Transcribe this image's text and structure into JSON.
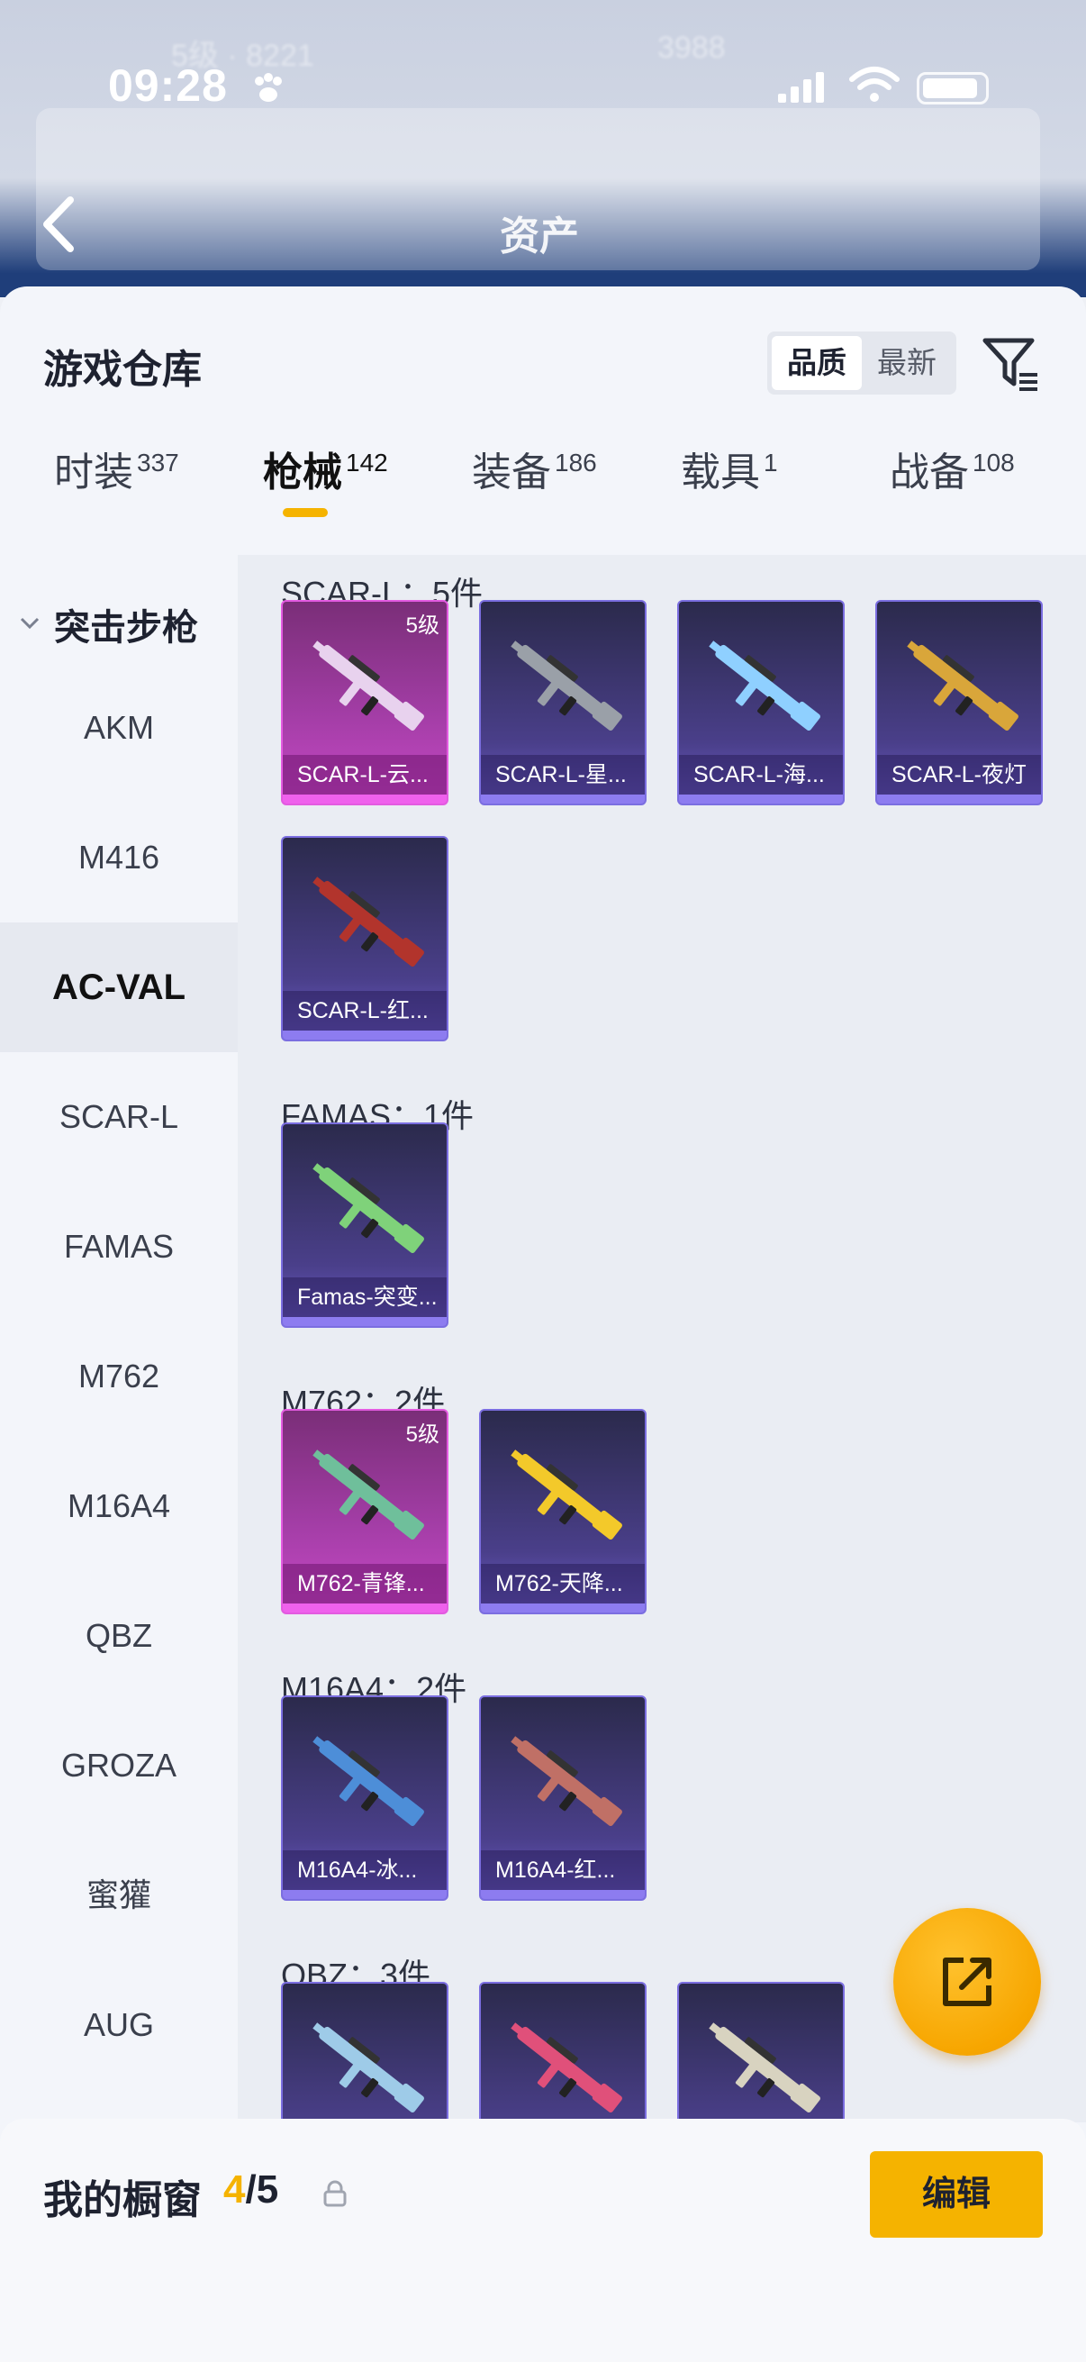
{
  "header": {
    "time": "09:28",
    "page_title": "资产"
  },
  "warehouse": {
    "title": "游戏仓库",
    "sort_options": [
      "品质",
      "最新"
    ],
    "sort_active": "品质"
  },
  "category_tabs": [
    {
      "label": "时装",
      "count": "337"
    },
    {
      "label": "枪械",
      "count": "142",
      "active": true
    },
    {
      "label": "装备",
      "count": "186"
    },
    {
      "label": "载具",
      "count": "1"
    },
    {
      "label": "战备",
      "count": "108"
    }
  ],
  "sidebar": {
    "group": "突击步枪",
    "items": [
      "AKM",
      "M416",
      "AC-VAL",
      "SCAR-L",
      "FAMAS",
      "M762",
      "M16A4",
      "QBZ",
      "GROZA",
      "蜜獾",
      "AUG"
    ],
    "active": "AC-VAL"
  },
  "sections": [
    {
      "title": "SCAR-L：5件",
      "items": [
        {
          "name": "SCAR-L-云...",
          "level": "5级",
          "quality": "q5",
          "gun_color": "#e8d2ee"
        },
        {
          "name": "SCAR-L-星...",
          "level": "",
          "quality": "q4",
          "gun_color": "#9aa0a8"
        },
        {
          "name": "SCAR-L-海...",
          "level": "",
          "quality": "q4",
          "gun_color": "#8fd0ff"
        },
        {
          "name": "SCAR-L-夜灯",
          "level": "",
          "quality": "q4",
          "gun_color": "#d9a63a"
        }
      ]
    },
    {
      "title": "",
      "items": [
        {
          "name": "SCAR-L-红...",
          "level": "",
          "quality": "q4",
          "gun_color": "#b2342c"
        }
      ]
    },
    {
      "title": "FAMAS：1件",
      "items": [
        {
          "name": "Famas-突变...",
          "level": "",
          "quality": "q4",
          "gun_color": "#7fd27a"
        }
      ]
    },
    {
      "title": "M762：2件",
      "items": [
        {
          "name": "M762-青锋...",
          "level": "5级",
          "quality": "q5",
          "gun_color": "#6fbf9b"
        },
        {
          "name": "M762-天降...",
          "level": "",
          "quality": "q4",
          "gun_color": "#f3c92a"
        }
      ]
    },
    {
      "title": "M16A4：2件",
      "items": [
        {
          "name": "M16A4-冰...",
          "level": "",
          "quality": "q4",
          "gun_color": "#4d8ed8"
        },
        {
          "name": "M16A4-红...",
          "level": "",
          "quality": "q4",
          "gun_color": "#c07066"
        }
      ]
    },
    {
      "title": "QBZ：3件",
      "items": [
        {
          "name": "",
          "level": "",
          "quality": "q4",
          "gun_color": "#9ecbe8"
        },
        {
          "name": "",
          "level": "",
          "quality": "q4",
          "gun_color": "#e0507a"
        },
        {
          "name": "",
          "level": "",
          "quality": "q4",
          "gun_color": "#d8d3c0"
        }
      ]
    }
  ],
  "showcase": {
    "title": "我的橱窗",
    "current": "4",
    "total": "/5",
    "edit_label": "编辑"
  },
  "icons": {
    "back": "chevron-left-icon",
    "filter": "filter-icon",
    "share": "share-icon",
    "lock": "lock-icon"
  },
  "colors": {
    "accent": "#f5b300",
    "quality5": "#c749c6",
    "quality4": "#6d5cc7"
  }
}
